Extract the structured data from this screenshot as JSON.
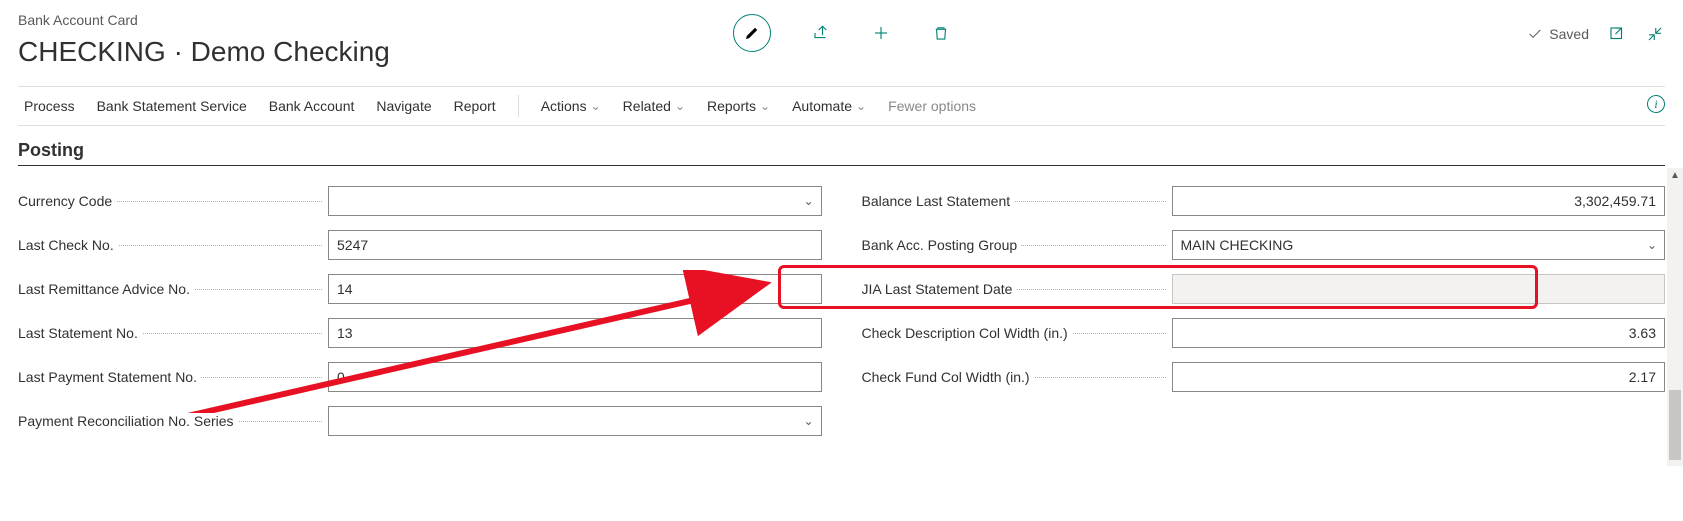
{
  "header": {
    "breadcrumb": "Bank Account Card",
    "title": "CHECKING · Demo Checking",
    "saved_label": "Saved"
  },
  "toolbar": {
    "process": "Process",
    "bank_statement_service": "Bank Statement Service",
    "bank_account": "Bank Account",
    "navigate": "Navigate",
    "report": "Report",
    "actions": "Actions",
    "related": "Related",
    "reports": "Reports",
    "automate": "Automate",
    "fewer_options": "Fewer options"
  },
  "section": {
    "posting": "Posting"
  },
  "fields": {
    "currency_code": {
      "label": "Currency Code",
      "value": ""
    },
    "last_check_no": {
      "label": "Last Check No.",
      "value": "5247"
    },
    "last_remittance_advice_no": {
      "label": "Last Remittance Advice No.",
      "value": "14"
    },
    "last_statement_no": {
      "label": "Last Statement No.",
      "value": "13"
    },
    "last_payment_statement_no": {
      "label": "Last Payment Statement No.",
      "value": "0"
    },
    "payment_reconciliation_no_series": {
      "label": "Payment Reconciliation No. Series",
      "value": ""
    },
    "balance_last_statement": {
      "label": "Balance Last Statement",
      "value": "3,302,459.71"
    },
    "bank_acc_posting_group": {
      "label": "Bank Acc. Posting Group",
      "value": "MAIN CHECKING"
    },
    "jia_last_statement_date": {
      "label": "JIA Last Statement Date",
      "value": ""
    },
    "check_description_col_width": {
      "label": "Check Description Col Width (in.)",
      "value": "3.63"
    },
    "check_fund_col_width": {
      "label": "Check Fund Col Width (in.)",
      "value": "2.17"
    }
  }
}
